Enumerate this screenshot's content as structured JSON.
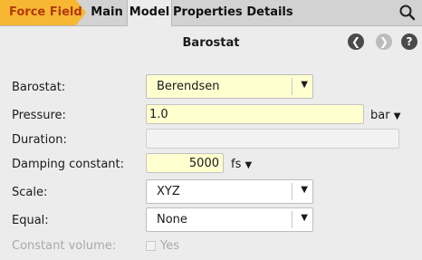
{
  "tabs": {
    "crumb": "Force Field",
    "main": "Main",
    "model": "Model",
    "properties": "Properties",
    "details": "Details"
  },
  "header": {
    "title": "Barostat"
  },
  "form": {
    "barostat": {
      "label": "Barostat:",
      "value": "Berendsen"
    },
    "pressure": {
      "label": "Pressure:",
      "value": "1.0",
      "unit": "bar"
    },
    "duration": {
      "label": "Duration:",
      "value": ""
    },
    "damping": {
      "label": "Damping constant:",
      "value": "5000",
      "unit": "fs"
    },
    "scale": {
      "label": "Scale:",
      "value": "XYZ"
    },
    "equal": {
      "label": "Equal:",
      "value": "None"
    },
    "constant_volume": {
      "label": "Constant volume:",
      "checkbox_label": "Yes",
      "checked": false
    }
  },
  "colors": {
    "crumb": "#f7b733",
    "input_highlight": "#ffffd0",
    "nav_button": "#4a4a4a",
    "nav_button_disabled": "#bcbcbc"
  },
  "icons": {
    "search": "search-icon",
    "back": "back-icon",
    "forward": "forward-icon",
    "help": "help-icon",
    "dropdown": "chevron-down-icon"
  }
}
